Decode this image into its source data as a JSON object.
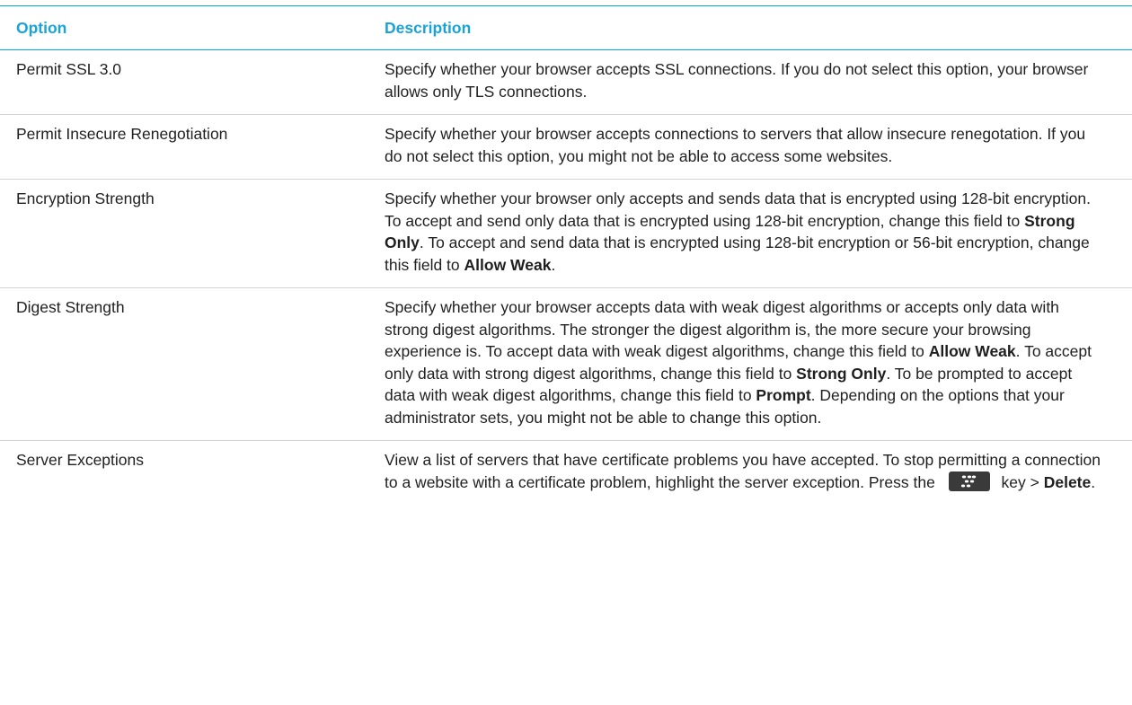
{
  "table": {
    "headers": {
      "option": "Option",
      "description": "Description"
    },
    "rows": [
      {
        "option": "Permit SSL 3.0",
        "description": [
          {
            "t": "Specify whether your browser accepts SSL connections. If you do not select this option, your browser allows only TLS connections."
          }
        ]
      },
      {
        "option": "Permit Insecure Renegotiation",
        "description": [
          {
            "t": "Specify whether your browser accepts connections to servers that allow insecure renegotation. If you do not select this option, you might not be able to access some websites."
          }
        ]
      },
      {
        "option": "Encryption Strength",
        "description": [
          {
            "t": "Specify whether your browser only accepts and sends data that is encrypted using 128-bit encryption. To accept and send only data that is encrypted using 128-bit encryption, change this field to "
          },
          {
            "b": "Strong Only"
          },
          {
            "t": ". To accept and send data that is encrypted using 128-bit encryption or 56-bit encryption, change this field to "
          },
          {
            "b": "Allow Weak"
          },
          {
            "t": "."
          }
        ]
      },
      {
        "option": "Digest Strength",
        "description": [
          {
            "t": "Specify whether your browser accepts data with weak digest algorithms or accepts only data with strong digest algorithms. The stronger the digest algorithm is, the more secure your browsing experience is. To accept data with weak digest algorithms, change this field to "
          },
          {
            "b": "Allow Weak"
          },
          {
            "t": ". To accept only data with strong digest algorithms, change this field to "
          },
          {
            "b": "Strong Only"
          },
          {
            "t": ". To be prompted to accept data with weak digest algorithms, change this field to "
          },
          {
            "b": "Prompt"
          },
          {
            "t": ". Depending on the options that your administrator sets, you might not be able to change this option."
          }
        ]
      },
      {
        "option": "Server Exceptions",
        "description": [
          {
            "t": "View a list of servers that have certificate problems you have accepted. To stop permitting a connection to a website with a certificate problem, highlight the server exception. Press the "
          },
          {
            "icon": "blackberry-menu-key-icon"
          },
          {
            "t": " key > "
          },
          {
            "b": "Delete"
          },
          {
            "t": "."
          }
        ]
      }
    ]
  },
  "colors": {
    "header_text": "#1aa3d9",
    "header_rule": "#00a9d6",
    "row_rule": "#d2d2d2",
    "key_icon_bg": "#3a3a3a"
  }
}
